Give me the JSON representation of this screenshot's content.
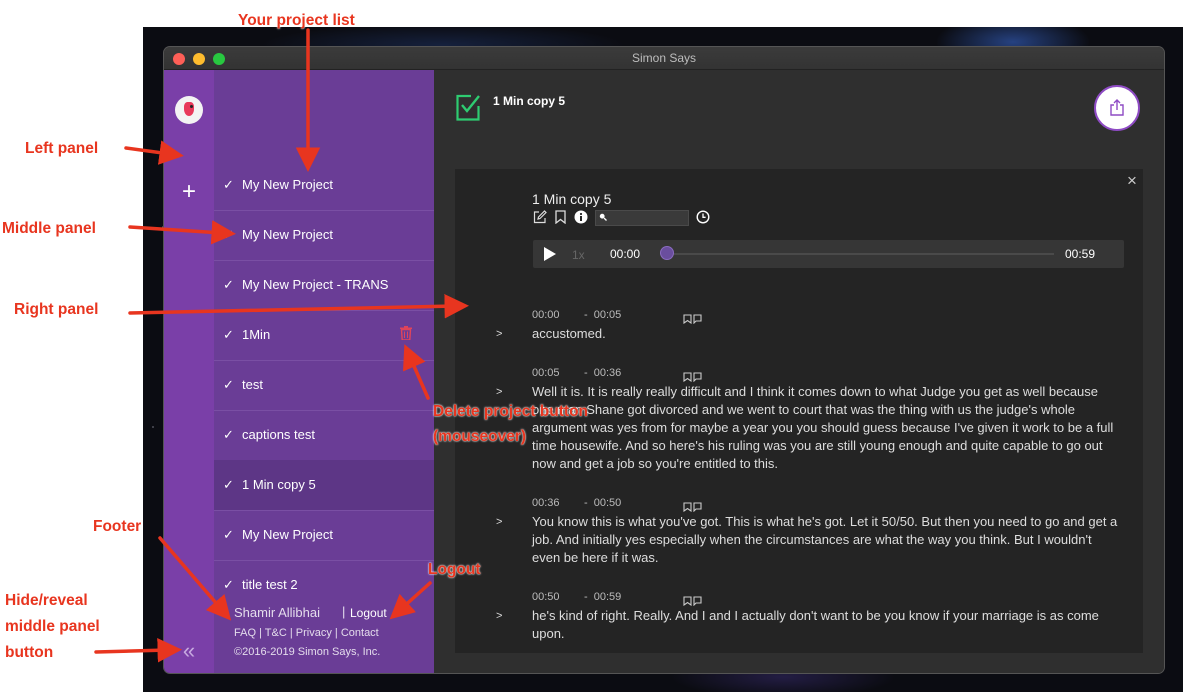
{
  "window": {
    "title": "Simon Says"
  },
  "projects": [
    {
      "name": "My New Project"
    },
    {
      "name": "My New Project"
    },
    {
      "name": "My New Project - TRANS"
    },
    {
      "name": "1Min"
    },
    {
      "name": "test"
    },
    {
      "name": "captions test"
    },
    {
      "name": "1 Min copy 5",
      "selected": true
    },
    {
      "name": "My New Project"
    },
    {
      "name": "title test 2"
    }
  ],
  "footer": {
    "user": "Shamir Allibhai",
    "separator": "|",
    "logout": "Logout",
    "links": [
      "FAQ",
      "T&C",
      "Privacy",
      "Contact"
    ],
    "link_separator": "|",
    "copyright": "©2016-2019 Simon Says, Inc."
  },
  "header": {
    "title": "1 Min copy 5"
  },
  "card": {
    "title": "1 Min copy 5",
    "close": "×",
    "search_value": "",
    "player": {
      "speed": "1x",
      "current_time": "00:00",
      "end_time": "00:59",
      "progress": 0
    }
  },
  "segments": [
    {
      "time": "00:00        -  00:05",
      "arrow": ">",
      "text": "accustomed."
    },
    {
      "time": "00:05        -  00:36",
      "arrow": ">",
      "text": "Well it is. It is really really difficult and I think it comes down to what Judge you get as well because one man Shane got divorced and we went to court that was the thing with us the judge's whole argument was yes from for maybe a year you you should guess because I've given it work to be a full time housewife. And so here's his ruling was you are still young enough and quite capable to go out now and get a job so you're entitled to this."
    },
    {
      "time": "00:36        -  00:50",
      "arrow": ">",
      "text": "You know this is what you've got. This is what he's got. Let it 50/50. But then you need to go and get a job. And initially yes especially when the circumstances are what the way you think. But I wouldn't even be here if it was."
    },
    {
      "time": "00:50        -  00:59",
      "arrow": ">",
      "text": "he's kind of right. Really. And I and I actually don't want to be you know if your marriage is as come upon."
    }
  ],
  "annotations": {
    "project_list": "Your project list",
    "left_panel": "Left panel",
    "middle_panel": "Middle panel",
    "right_panel": "Right panel",
    "delete_button_1": "Delete project button",
    "delete_button_2": "(mouseover)",
    "footer": "Footer",
    "logout": "Logout",
    "hide_reveal_1": "Hide/reveal",
    "hide_reveal_2": "middle panel",
    "hide_reveal_3": "button"
  },
  "colors": {
    "left_panel": "#7a3fa8",
    "middle_panel": "#6a3d96",
    "accent_green": "#2ecc71",
    "annotation_red": "#e8351f",
    "trash_red": "#e0445a"
  }
}
